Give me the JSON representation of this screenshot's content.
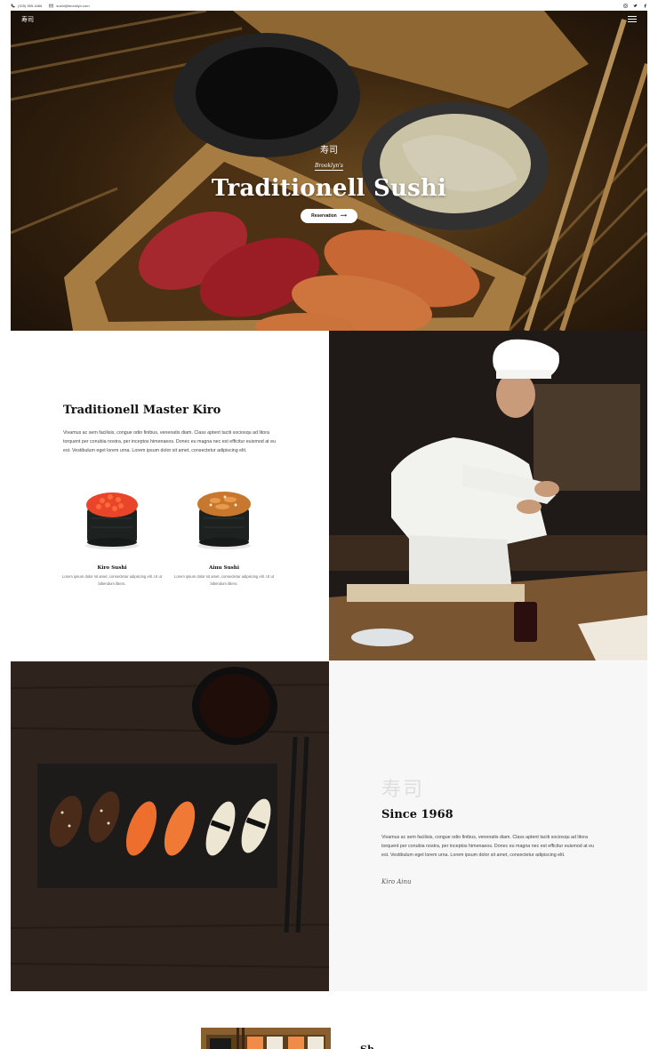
{
  "topbar": {
    "phone": "(325) 555-4466",
    "email": "sushi@brooklyn.com",
    "social_icons": [
      "instagram-icon",
      "twitter-icon",
      "facebook-icon"
    ]
  },
  "hero": {
    "logo": "寿司",
    "kanji": "寿司",
    "subtitle": "Brooklyn's",
    "title": "Traditionell Sushi",
    "button_label": "Reservation",
    "button_arrow": "⟶"
  },
  "master": {
    "title": "Traditionell Master Kiro",
    "body": "Vivamus ac sem facilisis, congue odio finibus, venenatis diam. Class aptent taciti sociosqu ad litora torquent per conubia nostra, per inceptos himenaeos. Donec eu magna nec est efficitur euismod at eu est. Vestibulum eget lorem urna. Lorem ipsum dolor sit amet, consectetur adipiscing elit.",
    "items": [
      {
        "name": "Kiro Sushi",
        "desc": "Lorem ipsum dolor sit amet, consectetur adipiscing elit. Ut ut bibendum libero."
      },
      {
        "name": "Ainu Sushi",
        "desc": "Lorem ipsum dolor sit amet, consectetur adipiscing elit. Ut ut bibendum libero."
      }
    ]
  },
  "since": {
    "kanji": "寿司",
    "title": "Since 1968",
    "body": "Vivamus ac sem facilisis, congue odio finibus, venenatis diam. Class aptent taciti sociosqu ad litora torquent per conubia nostra, per inceptos himenaeos. Donec eu magna nec est efficitur euismod at eu est. Vestibulum eget lorem urna. Lorem ipsum dolor sit amet, consectetur adipiscing elit.",
    "signature": "Kiro Ainu"
  },
  "footer_peek": {
    "title": "Sh"
  },
  "colors": {
    "accent_white": "#ffffff",
    "text_dark": "#111111",
    "panel_light": "#f7f7f7",
    "wood": "#8a5f2f"
  }
}
